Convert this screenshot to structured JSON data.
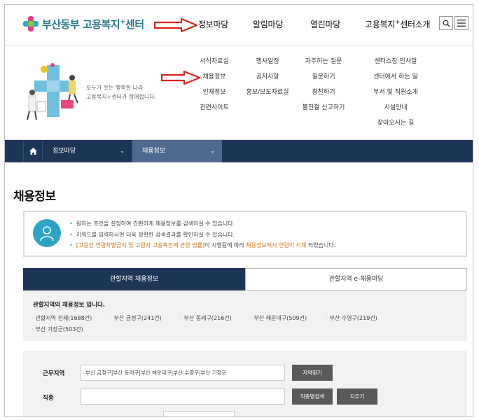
{
  "header": {
    "logo_text": "부산동부 고용복지",
    "logo_sup": "+",
    "logo_suffix": "센터",
    "nav": [
      {
        "label": "정보마당"
      },
      {
        "label": "알림마당"
      },
      {
        "label": "열린마당"
      },
      {
        "label": "고용복지",
        "sup": "+",
        "suffix": "센터소개"
      }
    ],
    "search_icon": "search-icon",
    "menu_icon": "hamburger-icon"
  },
  "mega": {
    "slogan_line1": "모두가 웃는 행복한 나라",
    "slogan_line2": "고용복지+센터가 함께합니다.",
    "columns": [
      [
        "서식자료실",
        "채용정보",
        "인재정보",
        "관련사이트"
      ],
      [
        "행사일정",
        "공지사항",
        "홍보/보도자료실"
      ],
      [
        "자주하는 질문",
        "질문하기",
        "칭찬하기",
        "불친절 신고하기"
      ],
      [
        "센터소장 인사말",
        "센터에서 하는 일",
        "부서 및 직원소개",
        "시설안내",
        "찾아오시는 길"
      ]
    ]
  },
  "breadcrumb": {
    "home_icon": "home-icon",
    "level1": "정보마당",
    "level2": "채용정보"
  },
  "page_title": "채용정보",
  "info": {
    "line1": "원하는 조건을 설정하여 간편하게 채용정보를 검색하실 수 있습니다.",
    "line2": "키워드를 입력하시면 더욱 정확한 검색결과를 확인하실 수 있습니다.",
    "line3_a": "[고용상 연령차별금지 및 고령자 고용촉진에 관한 법률]",
    "line3_b": "이 시행됨에 따라 ",
    "line3_c": "채용정보에서 연령이 삭제",
    "line3_d": " 되었습니다."
  },
  "tabs": {
    "active": "관할지역 채용정보",
    "inactive": "관할지역 e-채용마당"
  },
  "region": {
    "title": "관할지역의 채용정보 입니다.",
    "links": [
      "관할지역 전체(1688건)",
      "부산 금정구(241건)",
      "부산 동래구(216건)",
      "부산 해운대구(509건)",
      "부산 수영구(219건)",
      "부산 기장군(503건)"
    ]
  },
  "form": {
    "area_label": "근무지역",
    "area_value": "부산 금정구|부산 동래구|부산 해운대구|부산 수영구|부산 기장군",
    "area_button": "지역찾기",
    "job_label": "직종",
    "job_value": "",
    "job_search_button": "직종명검색",
    "clear_button": "지우기"
  },
  "colors": {
    "brand_teal": "#2a7a88",
    "nav_dark": "#1d3658",
    "nav_active": "#4f6a8e",
    "info_blue": "#2ea3c8",
    "highlight_orange": "#c8771a",
    "arrow_red": "#d9221c"
  }
}
